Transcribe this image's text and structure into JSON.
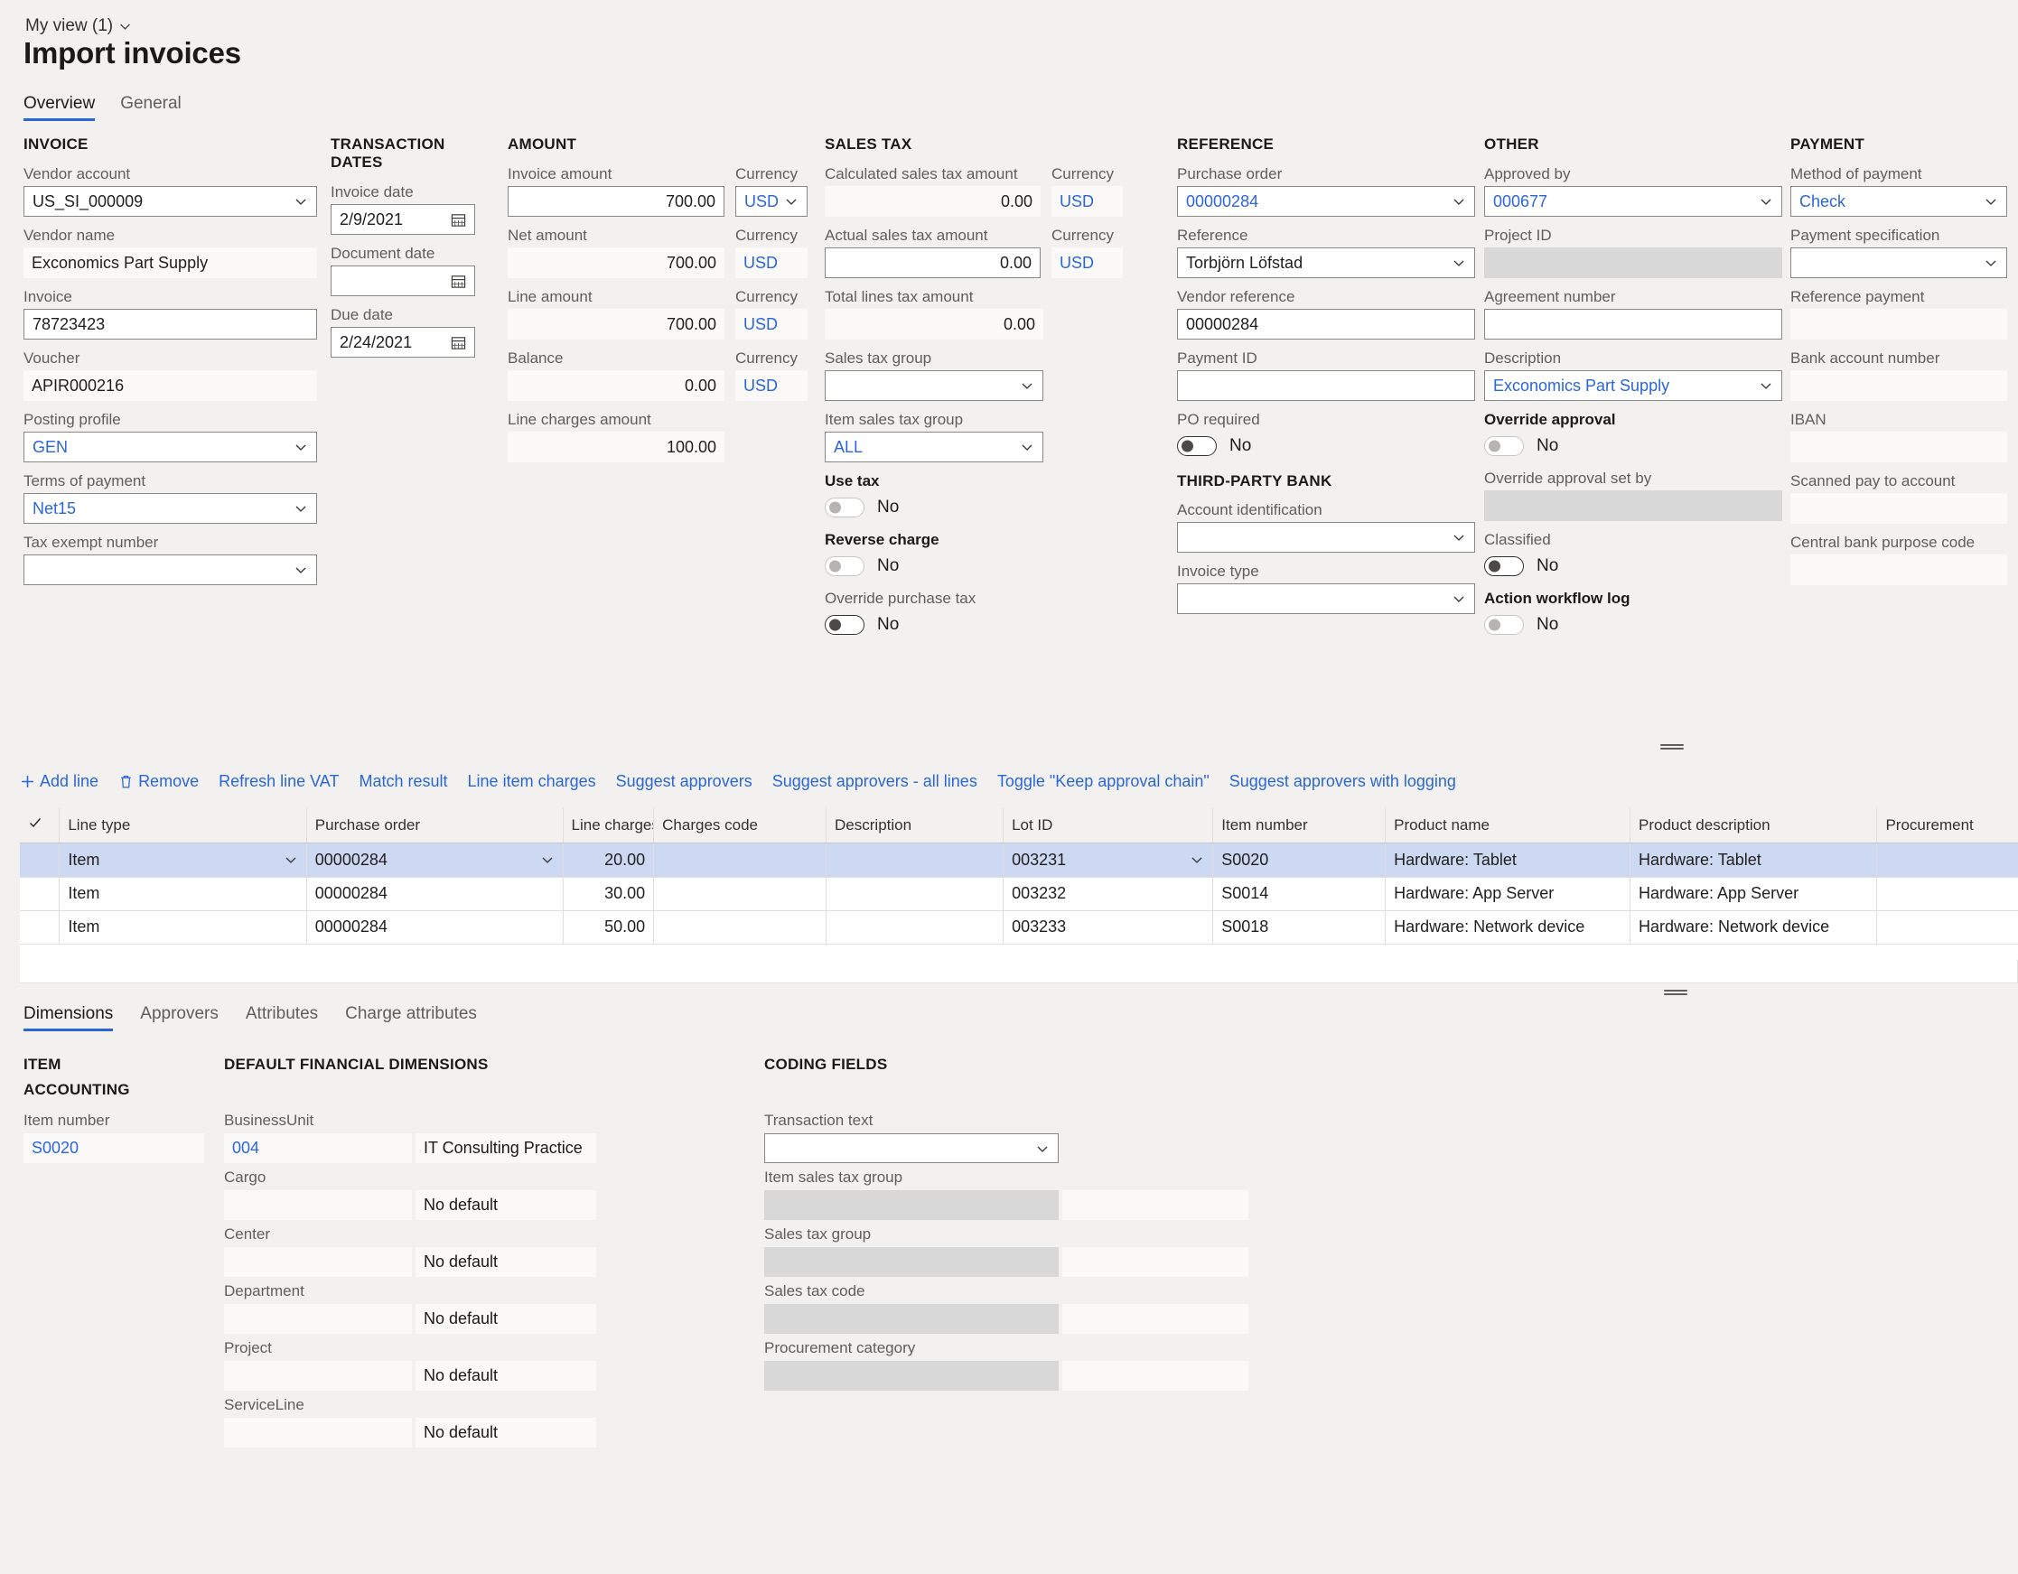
{
  "header": {
    "view_selector": "My view (1)",
    "title": "Import invoices",
    "tabs": [
      {
        "label": "Overview",
        "selected": true
      },
      {
        "label": "General",
        "selected": false
      }
    ]
  },
  "form": {
    "invoice": {
      "group": "INVOICE",
      "vendor_account_label": "Vendor account",
      "vendor_account_value": "US_SI_000009",
      "vendor_name_label": "Vendor name",
      "vendor_name_value": "Exconomics Part Supply",
      "invoice_label": "Invoice",
      "invoice_value": "78723423",
      "voucher_label": "Voucher",
      "voucher_value": "APIR000216",
      "posting_profile_label": "Posting profile",
      "posting_profile_value": "GEN",
      "terms_of_payment_label": "Terms of payment",
      "terms_of_payment_value": "Net15",
      "tax_exempt_number_label": "Tax exempt number",
      "tax_exempt_number_value": ""
    },
    "transaction_dates": {
      "group": "TRANSACTION DATES",
      "invoice_date_label": "Invoice date",
      "invoice_date_value": "2/9/2021",
      "document_date_label": "Document date",
      "document_date_value": "",
      "due_date_label": "Due date",
      "due_date_value": "2/24/2021"
    },
    "amount": {
      "group": "AMOUNT",
      "invoice_amount_label": "Invoice amount",
      "invoice_amount_value": "700.00",
      "invoice_amount_currency_label": "Currency",
      "invoice_amount_currency": "USD",
      "net_amount_label": "Net amount",
      "net_amount_value": "700.00",
      "net_amount_currency_label": "Currency",
      "net_amount_currency": "USD",
      "line_amount_label": "Line amount",
      "line_amount_value": "700.00",
      "line_amount_currency_label": "Currency",
      "line_amount_currency": "USD",
      "balance_label": "Balance",
      "balance_value": "0.00",
      "balance_currency_label": "Currency",
      "balance_currency": "USD",
      "line_charges_amount_label": "Line charges amount",
      "line_charges_amount_value": "100.00"
    },
    "sales_tax": {
      "group": "SALES TAX",
      "calculated_label": "Calculated sales tax amount",
      "calculated_value": "0.00",
      "calculated_currency_label": "Currency",
      "calculated_currency": "USD",
      "actual_label": "Actual sales tax amount",
      "actual_value": "0.00",
      "actual_currency_label": "Currency",
      "actual_currency": "USD",
      "total_lines_label": "Total lines tax amount",
      "total_lines_value": "0.00",
      "sales_tax_group_label": "Sales tax group",
      "sales_tax_group_value": "",
      "item_sales_tax_group_label": "Item sales tax group",
      "item_sales_tax_group_value": "ALL",
      "use_tax_label": "Use tax",
      "use_tax_value": "No",
      "reverse_charge_label": "Reverse charge",
      "reverse_charge_value": "No",
      "override_purchase_tax_label": "Override purchase tax",
      "override_purchase_tax_value": "No"
    },
    "reference": {
      "group": "REFERENCE",
      "purchase_order_label": "Purchase order",
      "purchase_order_value": "00000284",
      "reference_label": "Reference",
      "reference_value": "Torbjörn Löfstad",
      "vendor_reference_label": "Vendor reference",
      "vendor_reference_value": "00000284",
      "payment_id_label": "Payment ID",
      "payment_id_value": "",
      "po_required_label": "PO required",
      "po_required_value": "No",
      "third_party_bank_group": "THIRD-PARTY BANK",
      "account_identification_label": "Account identification",
      "account_identification_value": "",
      "invoice_type_label": "Invoice type",
      "invoice_type_value": ""
    },
    "other": {
      "group": "OTHER",
      "approved_by_label": "Approved by",
      "approved_by_value": "000677",
      "project_id_label": "Project ID",
      "project_id_value": "",
      "agreement_number_label": "Agreement number",
      "agreement_number_value": "",
      "description_label": "Description",
      "description_value": "Exconomics Part Supply",
      "override_approval_label": "Override approval",
      "override_approval_value": "No",
      "override_approval_set_by_label": "Override approval set by",
      "override_approval_set_by_value": "",
      "classified_label": "Classified",
      "classified_value": "No",
      "action_workflow_log_label": "Action workflow log",
      "action_workflow_log_value": "No"
    },
    "payment": {
      "group": "PAYMENT",
      "method_label": "Method of payment",
      "method_value": "Check",
      "payment_specification_label": "Payment specification",
      "payment_specification_value": "",
      "reference_payment_label": "Reference payment",
      "reference_payment_value": "",
      "bank_account_number_label": "Bank account number",
      "bank_account_number_value": "",
      "iban_label": "IBAN",
      "iban_value": "",
      "scanned_pay_to_account_label": "Scanned pay to account",
      "scanned_pay_to_account_value": "",
      "central_bank_purpose_code_label": "Central bank purpose code",
      "central_bank_purpose_code_value": ""
    }
  },
  "toolbar": {
    "add_line": "Add line",
    "remove": "Remove",
    "refresh_line_vat": "Refresh line VAT",
    "match_result": "Match result",
    "line_item_charges": "Line item charges",
    "suggest_approvers": "Suggest approvers",
    "suggest_approvers_all_lines": "Suggest approvers - all lines",
    "toggle_keep_approval_chain": "Toggle \"Keep approval chain\"",
    "suggest_approvers_with_logging": "Suggest approvers with logging"
  },
  "lines_grid": {
    "columns": [
      "Line type",
      "Purchase order",
      "Line charges ...",
      "Charges code",
      "Description",
      "Lot ID",
      "Item number",
      "Product name",
      "Product description",
      "Procurement"
    ],
    "rows": [
      {
        "selected": true,
        "line_type": "Item",
        "purchase_order": "00000284",
        "line_charges": "20.00",
        "charges_code": "",
        "description": "",
        "lot_id": "003231",
        "item_number": "S0020",
        "product_name": "Hardware: Tablet",
        "product_description": "Hardware: Tablet",
        "procurement": ""
      },
      {
        "selected": false,
        "line_type": "Item",
        "purchase_order": "00000284",
        "line_charges": "30.00",
        "charges_code": "",
        "description": "",
        "lot_id": "003232",
        "item_number": "S0014",
        "product_name": "Hardware: App Server",
        "product_description": "Hardware: App Server",
        "procurement": ""
      },
      {
        "selected": false,
        "line_type": "Item",
        "purchase_order": "00000284",
        "line_charges": "50.00",
        "charges_code": "",
        "description": "",
        "lot_id": "003233",
        "item_number": "S0018",
        "product_name": "Hardware: Network device",
        "product_description": "Hardware: Network device",
        "procurement": ""
      }
    ]
  },
  "bottom": {
    "tabs": [
      {
        "label": "Dimensions",
        "selected": true
      },
      {
        "label": "Approvers",
        "selected": false
      },
      {
        "label": "Attributes",
        "selected": false
      },
      {
        "label": "Charge attributes",
        "selected": false
      }
    ],
    "item_accounting": {
      "group_line1": "ITEM",
      "group_line2": "ACCOUNTING",
      "item_number_label": "Item number",
      "item_number_value": "S0020"
    },
    "default_financial_dimensions": {
      "group": "DEFAULT FINANCIAL DIMENSIONS",
      "rows": [
        {
          "label": "BusinessUnit",
          "value": "004",
          "desc": "IT Consulting Practice",
          "link": true
        },
        {
          "label": "Cargo",
          "value": "",
          "desc": "No default",
          "link": false
        },
        {
          "label": "Center",
          "value": "",
          "desc": "No default",
          "link": false
        },
        {
          "label": "Department",
          "value": "",
          "desc": "No default",
          "link": false
        },
        {
          "label": "Project",
          "value": "",
          "desc": "No default",
          "link": false
        },
        {
          "label": "ServiceLine",
          "value": "",
          "desc": "No default",
          "link": false
        }
      ]
    },
    "coding_fields": {
      "group": "CODING FIELDS",
      "transaction_text_label": "Transaction text",
      "transaction_text_value": "",
      "rows": [
        {
          "label": "Item sales tax group",
          "value": "",
          "desc": ""
        },
        {
          "label": "Sales tax group",
          "value": "",
          "desc": ""
        },
        {
          "label": "Sales tax code",
          "value": "",
          "desc": ""
        },
        {
          "label": "Procurement category",
          "value": "",
          "desc": ""
        }
      ]
    }
  },
  "colors": {
    "accent": "#2b66d9",
    "page_bg": "#f2f1f0",
    "selected_row": "#cdd9f2"
  }
}
